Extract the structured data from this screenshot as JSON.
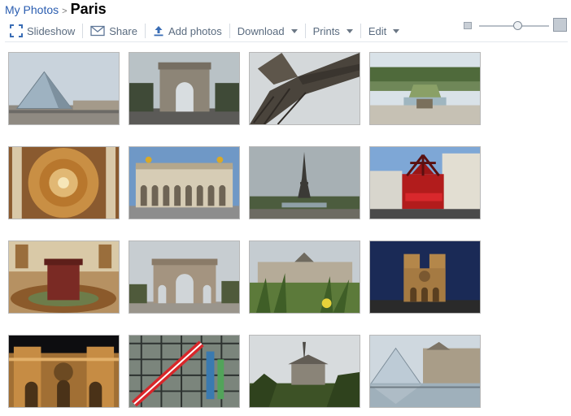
{
  "breadcrumb": {
    "root": "My Photos",
    "separator": ">",
    "title": "Paris"
  },
  "toolbar": {
    "slideshow": "Slideshow",
    "share": "Share",
    "add_photos": "Add photos",
    "download": "Download",
    "prints": "Prints",
    "edit": "Edit"
  },
  "zoom": {
    "level": 0.55
  },
  "colors": {
    "link": "#2a5db0",
    "toolbar_text": "#5a6b7f",
    "thumb_border": "#b8b8b8"
  },
  "photos": [
    {
      "subject": "louvre-pyramid"
    },
    {
      "subject": "arc-de-triomphe"
    },
    {
      "subject": "eiffel-tower-from-below"
    },
    {
      "subject": "versailles-gardens"
    },
    {
      "subject": "invalides-dome"
    },
    {
      "subject": "palais-garnier"
    },
    {
      "subject": "eiffel-tower-distant"
    },
    {
      "subject": "moulin-rouge"
    },
    {
      "subject": "napoleon-tomb"
    },
    {
      "subject": "arc-du-carrousel"
    },
    {
      "subject": "luxembourg-palace"
    },
    {
      "subject": "notre-dame-night"
    },
    {
      "subject": "notre-dame-illuminated"
    },
    {
      "subject": "centre-pompidou"
    },
    {
      "subject": "notre-dame-from-park"
    },
    {
      "subject": "louvre-pyramid-reflection"
    }
  ]
}
